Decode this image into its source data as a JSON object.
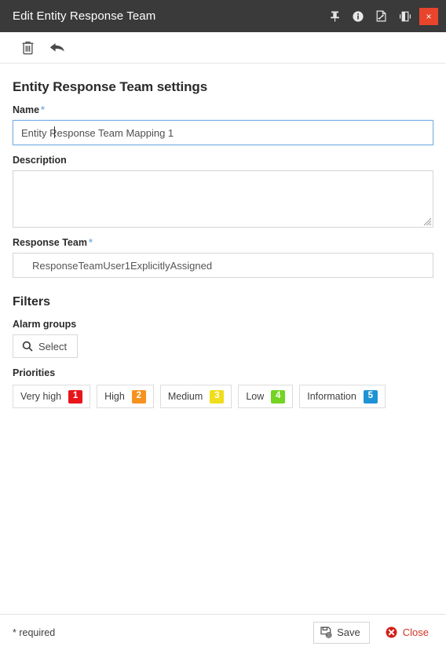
{
  "window": {
    "title": "Edit Entity Response Team",
    "titlebar_bg": "#3a3a3a",
    "close_bg": "#e8452c",
    "actions": [
      {
        "name": "pin-icon",
        "label": "Pin"
      },
      {
        "name": "info-icon",
        "label": "Info"
      },
      {
        "name": "pdf-export-icon",
        "label": "Export to PDF"
      },
      {
        "name": "dock-panel-icon",
        "label": "Dock"
      }
    ],
    "close_label": "×"
  },
  "toolbar": {
    "delete_label": "Delete",
    "undo_label": "Undo"
  },
  "form": {
    "section_title": "Entity Response Team settings",
    "name": {
      "label": "Name",
      "required_marker": "*",
      "value": "Entity Response Team Mapping 1",
      "placeholder": "",
      "focused": true
    },
    "description": {
      "label": "Description",
      "value": "",
      "placeholder": ""
    },
    "response_team": {
      "label": "Response Team",
      "required_marker": "*",
      "value": "ResponseTeamUser1ExplicitlyAssigned",
      "placeholder": ""
    }
  },
  "filters": {
    "title": "Filters",
    "alarm_groups": {
      "label": "Alarm groups",
      "select_button": "Select",
      "icon": "search-icon"
    },
    "priorities": {
      "label": "Priorities",
      "items": [
        {
          "label": "Very high",
          "number": "1",
          "color": "#e8151b"
        },
        {
          "label": "High",
          "number": "2",
          "color": "#f6921e"
        },
        {
          "label": "Medium",
          "number": "3",
          "color": "#f0dd1b"
        },
        {
          "label": "Low",
          "number": "4",
          "color": "#73d423"
        },
        {
          "label": "Information",
          "number": "5",
          "color": "#1e92d6"
        }
      ]
    }
  },
  "footer": {
    "required_note": "* required",
    "save_label": "Save",
    "close_label": "Close",
    "close_color": "#d33226"
  }
}
